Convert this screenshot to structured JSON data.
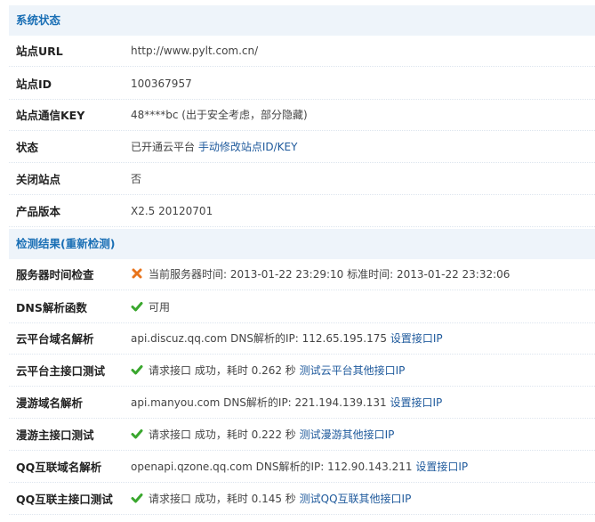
{
  "status_section": {
    "title": "系统状态",
    "rows": [
      {
        "label": "站点URL",
        "value": "http://www.pylt.com.cn/"
      },
      {
        "label": "站点ID",
        "value": "100367957"
      },
      {
        "label": "站点通信KEY",
        "value": "48****bc (出于安全考虑，部分隐藏)"
      },
      {
        "label": "状态",
        "value": "已开通云平台",
        "link": "手动修改站点ID/KEY"
      },
      {
        "label": "关闭站点",
        "value": "否"
      },
      {
        "label": "产品版本",
        "value": "X2.5 20120701"
      }
    ]
  },
  "check_section": {
    "title": "检测结果(重新检测)",
    "rows": [
      {
        "label": "服务器时间检查",
        "status": "fail",
        "icon": "cross-icon",
        "value": "当前服务器时间: 2013-01-22 23:29:10 标准时间: 2013-01-22 23:32:06"
      },
      {
        "label": "DNS解析函数",
        "status": "ok",
        "icon": "check-icon",
        "value": "可用"
      },
      {
        "label": "云平台域名解析",
        "value": "api.discuz.qq.com DNS解析的IP: 112.65.195.175",
        "link": "设置接口IP"
      },
      {
        "label": "云平台主接口测试",
        "status": "ok",
        "icon": "check-icon",
        "value": "请求接口 成功，耗时 0.262 秒",
        "link": "测试云平台其他接口IP"
      },
      {
        "label": "漫游域名解析",
        "value": "api.manyou.com DNS解析的IP: 221.194.139.131",
        "link": "设置接口IP"
      },
      {
        "label": "漫游主接口测试",
        "status": "ok",
        "icon": "check-icon",
        "value": "请求接口 成功，耗时 0.222 秒",
        "link": "测试漫游其他接口IP"
      },
      {
        "label": "QQ互联域名解析",
        "value": "openapi.qzone.qq.com DNS解析的IP: 112.90.143.211",
        "link": "设置接口IP"
      },
      {
        "label": "QQ互联主接口测试",
        "status": "ok",
        "icon": "check-icon",
        "value": "请求接口 成功，耗时 0.145 秒",
        "link": "测试QQ互联其他接口IP"
      }
    ]
  },
  "colors": {
    "accent": "#1a6fb5",
    "header_bg": "#eef4fa",
    "ok": "#3aa72e",
    "fail": "#e8741c",
    "link": "#1f5a9c"
  }
}
